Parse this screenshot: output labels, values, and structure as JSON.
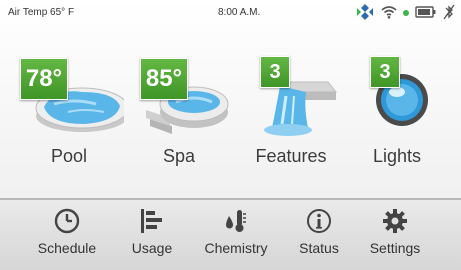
{
  "status_bar": {
    "air_temp": "Air Temp 65° F",
    "time": "8:00 A.M.",
    "connection_dot_color": "#39b54a"
  },
  "tiles": [
    {
      "label": "Pool",
      "badge": "78°",
      "icon": "pool-icon"
    },
    {
      "label": "Spa",
      "badge": "85°",
      "icon": "spa-icon"
    },
    {
      "label": "Features",
      "badge": "3",
      "icon": "waterfall-icon"
    },
    {
      "label": "Lights",
      "badge": "3",
      "icon": "light-bulb-icon"
    }
  ],
  "nav": [
    {
      "label": "Schedule",
      "icon": "clock-icon"
    },
    {
      "label": "Usage",
      "icon": "bar-chart-icon"
    },
    {
      "label": "Chemistry",
      "icon": "thermometer-drop-icon"
    },
    {
      "label": "Status",
      "icon": "info-icon"
    },
    {
      "label": "Settings",
      "icon": "gear-icon"
    }
  ],
  "colors": {
    "badge_green": "#4ba82f",
    "water_blue": "#5ab6e8",
    "icon_gray": "#4a4a4a"
  }
}
